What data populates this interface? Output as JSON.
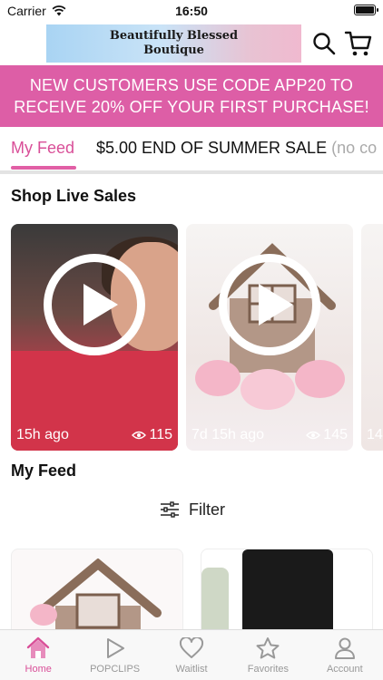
{
  "status": {
    "carrier": "Carrier",
    "time": "16:50"
  },
  "header": {
    "logo_line1": "Beautifully Blessed",
    "logo_line2": "Boutique"
  },
  "promo": {
    "text": "NEW CUSTOMERS USE CODE APP20 TO RECEIVE 20% OFF YOUR FIRST PURCHASE!"
  },
  "tabs": [
    {
      "label": "My Feed",
      "active": true
    },
    {
      "label": "$5.00 END OF SUMMER SALE",
      "suffix": "(no co"
    }
  ],
  "live": {
    "title": "Shop Live Sales",
    "cards": [
      {
        "time": "15h ago",
        "views": "115"
      },
      {
        "time": "7d 15h ago",
        "views": "145"
      },
      {
        "time": "14"
      }
    ]
  },
  "feed": {
    "title": "My Feed",
    "filter_label": "Filter"
  },
  "nav": [
    {
      "label": "Home",
      "icon": "home-icon",
      "active": true
    },
    {
      "label": "POPCLIPS",
      "icon": "play-icon"
    },
    {
      "label": "Waitlist",
      "icon": "heart-icon"
    },
    {
      "label": "Favorites",
      "icon": "star-icon"
    },
    {
      "label": "Account",
      "icon": "person-icon"
    }
  ],
  "colors": {
    "accent": "#dd5ea6",
    "tab_active": "#d94f98"
  }
}
